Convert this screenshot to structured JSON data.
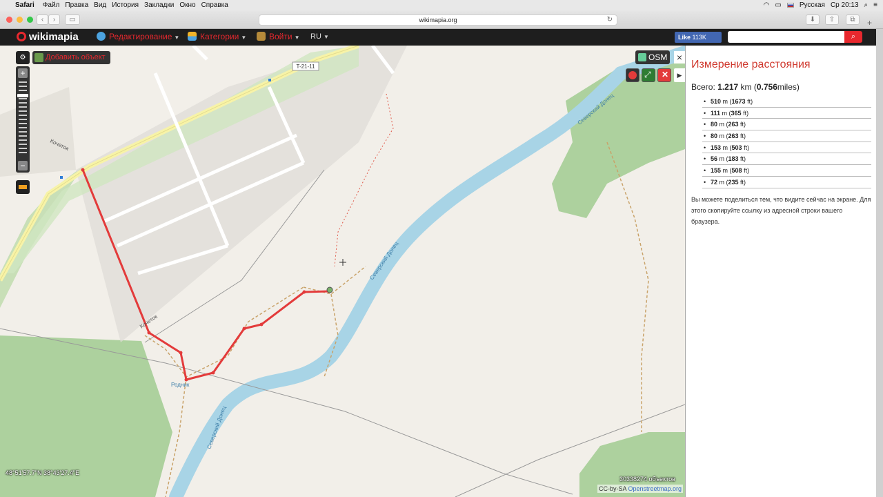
{
  "menubar": {
    "app": "Safari",
    "items": [
      "Файл",
      "Правка",
      "Вид",
      "История",
      "Закладки",
      "Окно",
      "Справка"
    ],
    "input_lang": "Русская",
    "clock": "Ср 20:13"
  },
  "browser": {
    "url": "wikimapia.org"
  },
  "header": {
    "logo": "wikimapia",
    "nav": [
      {
        "label": "Редактирование"
      },
      {
        "label": "Категории"
      },
      {
        "label": "Войти"
      }
    ],
    "lang": "RU",
    "fb_like_label": "Like",
    "fb_like_count": "113K",
    "search_placeholder": ""
  },
  "map": {
    "add_object_label": "Добавить объект",
    "osm_label": "OSM",
    "coordinates": "48°51'57.7\"N 38°43'27.4\"E",
    "object_count": "30338274 объектов",
    "attribution_prefix": "CC-by-SA ",
    "attribution_link": "Openstreetmap.org",
    "labels": {
      "road_ref": "T-21-11",
      "street_1": "Кочеток",
      "street_2": "Кочеток",
      "river_1": "Северский Донец",
      "river_2": "Северский Донец",
      "river_3": "Северский Донец",
      "spring": "Родник"
    }
  },
  "panel": {
    "title": "Измерение расстояния",
    "total_prefix": "Всего: ",
    "total_km": "1.217",
    "total_km_unit": " km (",
    "total_miles": "0.756",
    "total_miles_unit": "miles)",
    "segments": [
      {
        "m": "510",
        "ft": "1673"
      },
      {
        "m": "111",
        "ft": "365"
      },
      {
        "m": "80",
        "ft": "263"
      },
      {
        "m": "80",
        "ft": "263"
      },
      {
        "m": "153",
        "ft": "503"
      },
      {
        "m": "56",
        "ft": "183"
      },
      {
        "m": "155",
        "ft": "508"
      },
      {
        "m": "72",
        "ft": "235"
      }
    ],
    "note": "Вы можете поделиться тем, что видите сейчас на экране. Для этого скопируйте ссылку из адресной строки вашего браузера."
  },
  "colors": {
    "brand_red": "#e8282e",
    "route_red": "#e33b3b",
    "river_blue": "#a8d4e6",
    "forest_green": "#add19e",
    "panel_title": "#d03a2f"
  }
}
